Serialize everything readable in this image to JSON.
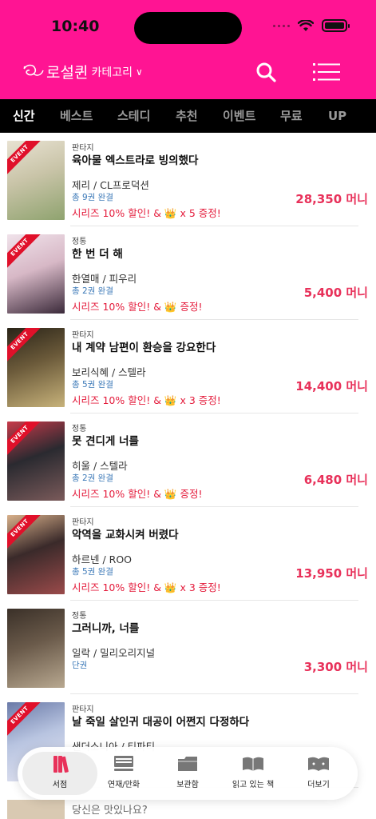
{
  "status": {
    "time": "10:40"
  },
  "header": {
    "logo_text": "로설퀸",
    "category_label": "카테고리",
    "category_chevron": "∨",
    "bg_color": "#ff1493"
  },
  "tabs": [
    {
      "label": "신간",
      "active": true
    },
    {
      "label": "베스트",
      "active": false
    },
    {
      "label": "스테디",
      "active": false
    },
    {
      "label": "추천",
      "active": false
    },
    {
      "label": "이벤트",
      "active": false
    },
    {
      "label": "무료",
      "active": false
    },
    {
      "label": "UP",
      "active": false
    }
  ],
  "books": [
    {
      "genre": "판타지",
      "title": "육아물 엑스트라로 빙의했다",
      "author": "제리 / CL프로덕션",
      "volumes": "총 9권 완결",
      "promo": "시리즈 10% 할인! & 👑 x 5 증정!",
      "price": "28,350 머니",
      "event": true,
      "cover_colors": [
        "#c9c4a8",
        "#8fa36f",
        "#e8e2d2"
      ]
    },
    {
      "genre": "정통",
      "title": "한 번 더 해",
      "author": "한열매 / 피우리",
      "volumes": "총 2권 완결",
      "promo": "시리즈 10% 할인! & 👑 증정!",
      "price": "5,400 머니",
      "event": true,
      "cover_colors": [
        "#d7b8c6",
        "#3b2a3a",
        "#f0e2ea"
      ]
    },
    {
      "genre": "판타지",
      "title": "내 계약 남편이 환승을 강요한다",
      "author": "보리식혜 / 스텔라",
      "volumes": "총 5권 완결",
      "promo": "시리즈 10% 할인! & 👑 x 3 증정!",
      "price": "14,400 머니",
      "event": true,
      "cover_colors": [
        "#6b5a3a",
        "#c7b27a",
        "#2a2418"
      ]
    },
    {
      "genre": "정통",
      "title": "못 견디게 너를",
      "author": "히울 / 스텔라",
      "volumes": "총 2권 완결",
      "promo": "시리즈 10% 할인! & 👑 증정!",
      "price": "6,480 머니",
      "event": true,
      "cover_colors": [
        "#2a2a30",
        "#7a5a5a",
        "#c73a4a"
      ]
    },
    {
      "genre": "판타지",
      "title": "악역을 교화시켜 버렸다",
      "author": "하르넨 / ROO",
      "volumes": "총 5권 완결",
      "promo": "시리즈 10% 할인! & 👑 x 3 증정!",
      "price": "13,950 머니",
      "event": true,
      "cover_colors": [
        "#3a2a2a",
        "#9a4a4a",
        "#d8b08a"
      ]
    },
    {
      "genre": "정통",
      "title": "그러니까, 너를",
      "author": "일락 / 밀리오리지널",
      "volumes": "단권",
      "promo": "",
      "price": "3,300 머니",
      "event": false,
      "cover_colors": [
        "#6a5a4a",
        "#b8a890",
        "#3a3028"
      ]
    },
    {
      "genre": "판타지",
      "title": "날 죽일 살인귀 대공이 어쩐지 다정하다",
      "author": "샌더소니아 / 티파티",
      "volumes": "",
      "promo": "",
      "price": "",
      "event": true,
      "cover_colors": [
        "#b8c4e0",
        "#e8e8f4",
        "#6a7aa8"
      ]
    }
  ],
  "event_label": "EVENT",
  "peek": {
    "title": "당신은 맛있나요?"
  },
  "bottom_nav": [
    {
      "label": "서점",
      "icon": "books-icon",
      "selected": true
    },
    {
      "label": "연재/만화",
      "icon": "stack-icon",
      "selected": false
    },
    {
      "label": "보관함",
      "icon": "folder-icon",
      "selected": false
    },
    {
      "label": "읽고 있는 책",
      "icon": "open-book-icon",
      "selected": false
    },
    {
      "label": "더보기",
      "icon": "more-book-icon",
      "selected": false
    }
  ],
  "colors": {
    "accent": "#ff1493",
    "price": "#e8315a",
    "promo": "#e41b3b",
    "volumes": "#3d7ab8"
  }
}
